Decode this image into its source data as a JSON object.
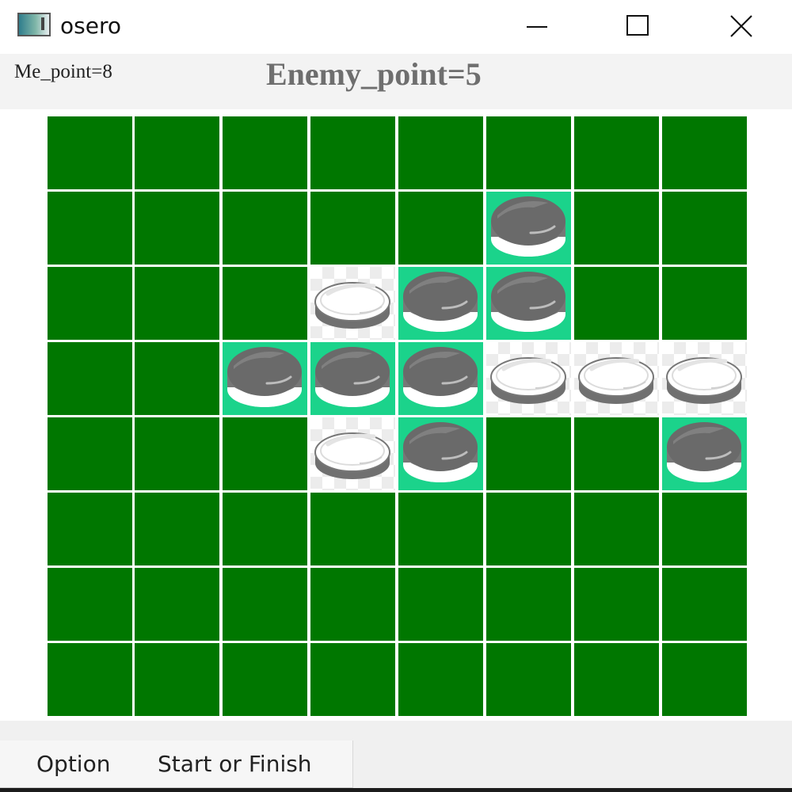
{
  "window": {
    "title": "osero"
  },
  "window_controls": {
    "minimize": "minimize-icon",
    "maximize": "maximize-icon",
    "close": "close-icon"
  },
  "scores": {
    "me": "Me_point=8",
    "enemy": "Enemy_point=5"
  },
  "menu": {
    "option_label": "Option",
    "start_label": "Start or Finish"
  },
  "colors": {
    "board": "#007700",
    "highlight": "#1bd38b",
    "black_disc": "#6f6f6f",
    "white_disc": "#ffffff",
    "grid_line": "#ffffff"
  },
  "board": {
    "rows": 8,
    "cols": 8,
    "cells": [
      [
        "",
        "",
        "",
        "",
        "",
        "",
        "",
        ""
      ],
      [
        "",
        "",
        "",
        "",
        "",
        "B",
        "",
        ""
      ],
      [
        "",
        "",
        "",
        "W",
        "B",
        "B",
        "",
        ""
      ],
      [
        "",
        "",
        "B",
        "B",
        "B",
        "W",
        "W",
        "W"
      ],
      [
        "",
        "",
        "",
        "W",
        "B",
        "",
        "",
        "B"
      ],
      [
        "",
        "",
        "",
        "",
        "",
        "",
        "",
        ""
      ],
      [
        "",
        "",
        "",
        "",
        "",
        "",
        "",
        ""
      ],
      [
        "",
        "",
        "",
        "",
        "",
        "",
        "",
        ""
      ]
    ]
  }
}
